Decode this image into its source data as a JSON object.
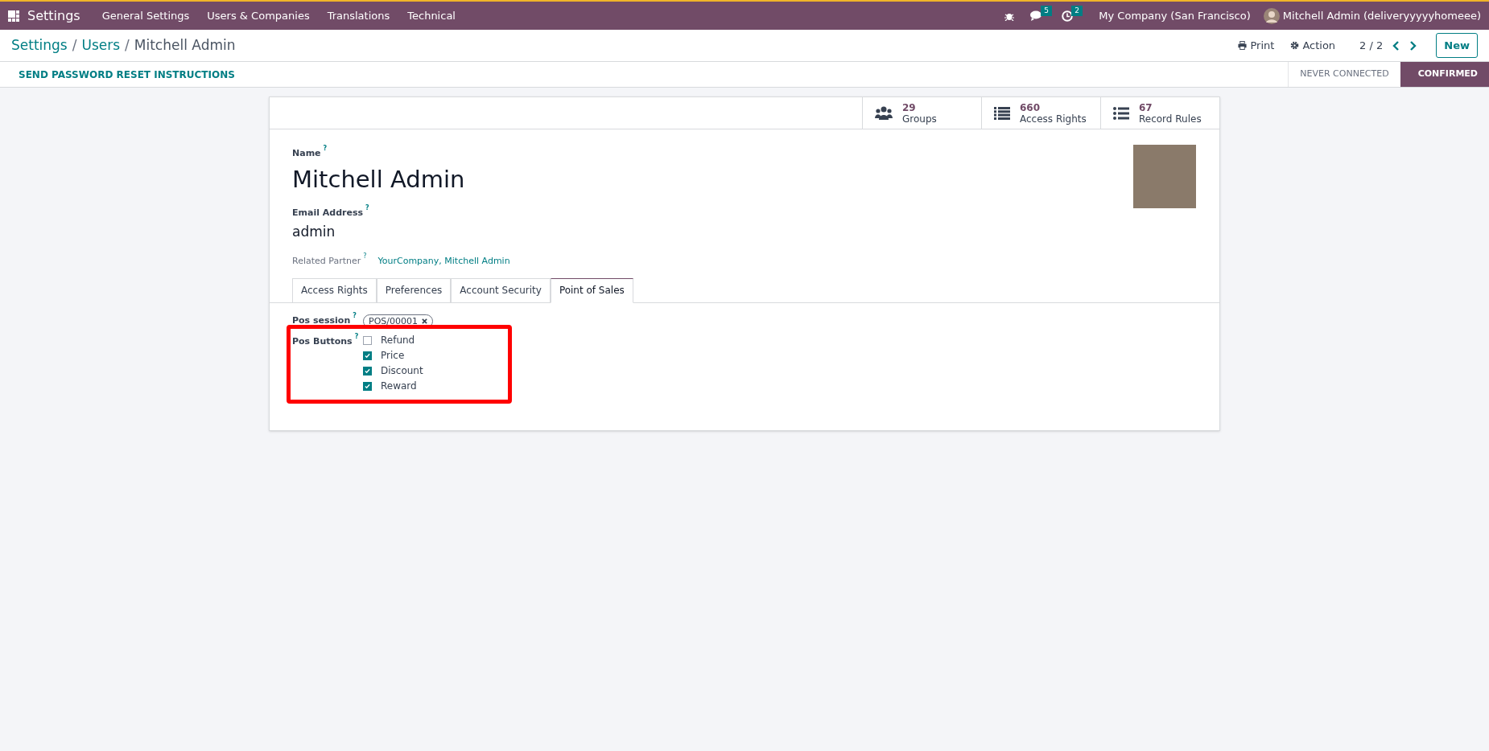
{
  "navbar": {
    "app_name": "Settings",
    "menu": [
      "General Settings",
      "Users & Companies",
      "Translations",
      "Technical"
    ],
    "messages_count": "5",
    "activities_count": "2",
    "company": "My Company (San Francisco)",
    "user": "Mitchell Admin (deliveryyyyyhomeee)"
  },
  "breadcrumb": [
    "Settings",
    "Users",
    "Mitchell Admin"
  ],
  "breadcrumb_separators": [
    "/",
    "/"
  ],
  "control_panel": {
    "print": "Print",
    "action": "Action",
    "pager": "2 / 2",
    "new_button": "New"
  },
  "action_buttons": [
    "SEND PASSWORD RESET INSTRUCTIONS"
  ],
  "status_steps": [
    {
      "label": "NEVER CONNECTED",
      "selected": false
    },
    {
      "label": "CONFIRMED",
      "selected": true
    }
  ],
  "stat_buttons": [
    {
      "kind": "groups",
      "value": "29",
      "label": "Groups"
    },
    {
      "kind": "list",
      "value": "660",
      "label": "Access Rights"
    },
    {
      "kind": "rules",
      "value": "67",
      "label": "Record Rules"
    }
  ],
  "name_label": "Name",
  "name": "Mitchell Admin",
  "email_label": "Email Address",
  "email": "admin",
  "partner_label": "Related Partner",
  "partner": "YourCompany, Mitchell Admin",
  "help_mark": "?",
  "tabs": [
    {
      "label": "Access Rights",
      "selected": false
    },
    {
      "label": "Preferences",
      "selected": false
    },
    {
      "label": "Account Security",
      "selected": false
    },
    {
      "label": "Point of Sales",
      "selected": true
    }
  ],
  "pos_session_label": "Pos session",
  "pos_session_tag": "POS/00001",
  "pos_buttons_label": "Pos Buttons",
  "pos_buttons": [
    {
      "label": "Refund",
      "checked": false
    },
    {
      "label": "Price",
      "checked": true
    },
    {
      "label": "Discount",
      "checked": true
    },
    {
      "label": "Reward",
      "checked": true
    }
  ]
}
